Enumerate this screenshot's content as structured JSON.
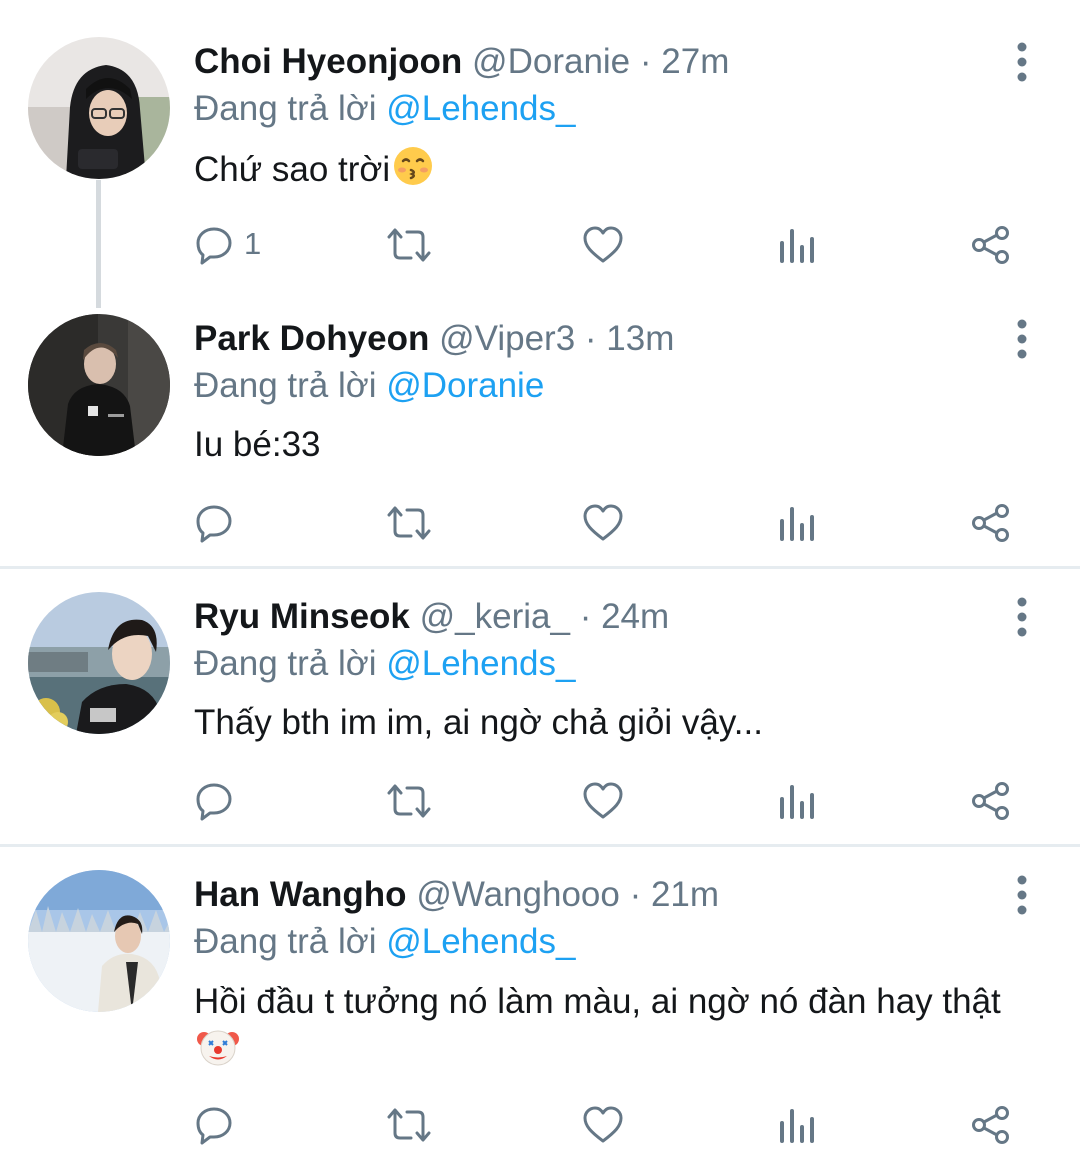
{
  "tweets": [
    {
      "name": "Choi Hyeonjoon",
      "handle": "@Doranie",
      "dot": "·",
      "time": "27m",
      "reply_prefix": "Đang trả lời",
      "reply_to": "@Lehends_",
      "text": "Chứ sao trời",
      "emoji": "kissing-face-emoji",
      "reply_count": "1"
    },
    {
      "name": "Park Dohyeon",
      "handle": "@Viper3",
      "dot": "·",
      "time": "13m",
      "reply_prefix": "Đang trả lời",
      "reply_to": "@Doranie",
      "text": "Iu bé:33",
      "reply_count": ""
    },
    {
      "name": "Ryu Minseok",
      "handle": "@_keria_",
      "dot": "·",
      "time": "24m",
      "reply_prefix": "Đang trả lời",
      "reply_to": "@Lehends_",
      "text": "Thấy bth im im, ai ngờ chả giỏi vậy...",
      "reply_count": ""
    },
    {
      "name": "Han Wangho",
      "handle": "@Wanghooo",
      "dot": "·",
      "time": "21m",
      "reply_prefix": "Đang trả lời",
      "reply_to": "@Lehends_",
      "text": "Hồi đầu t tưởng nó làm màu, ai ngờ nó đàn hay thật",
      "emoji": "clown-face-emoji",
      "reply_count": ""
    }
  ],
  "icons": {
    "reply": "reply-icon",
    "retweet": "retweet-icon",
    "like": "like-icon",
    "views": "analytics-icon",
    "share": "share-icon",
    "more": "more-vertical-icon"
  },
  "colors": {
    "text": "#14171a",
    "secondary": "#657786",
    "link": "#1da1f2",
    "divider": "#e6ecf0",
    "thread_line": "#d5dade"
  }
}
